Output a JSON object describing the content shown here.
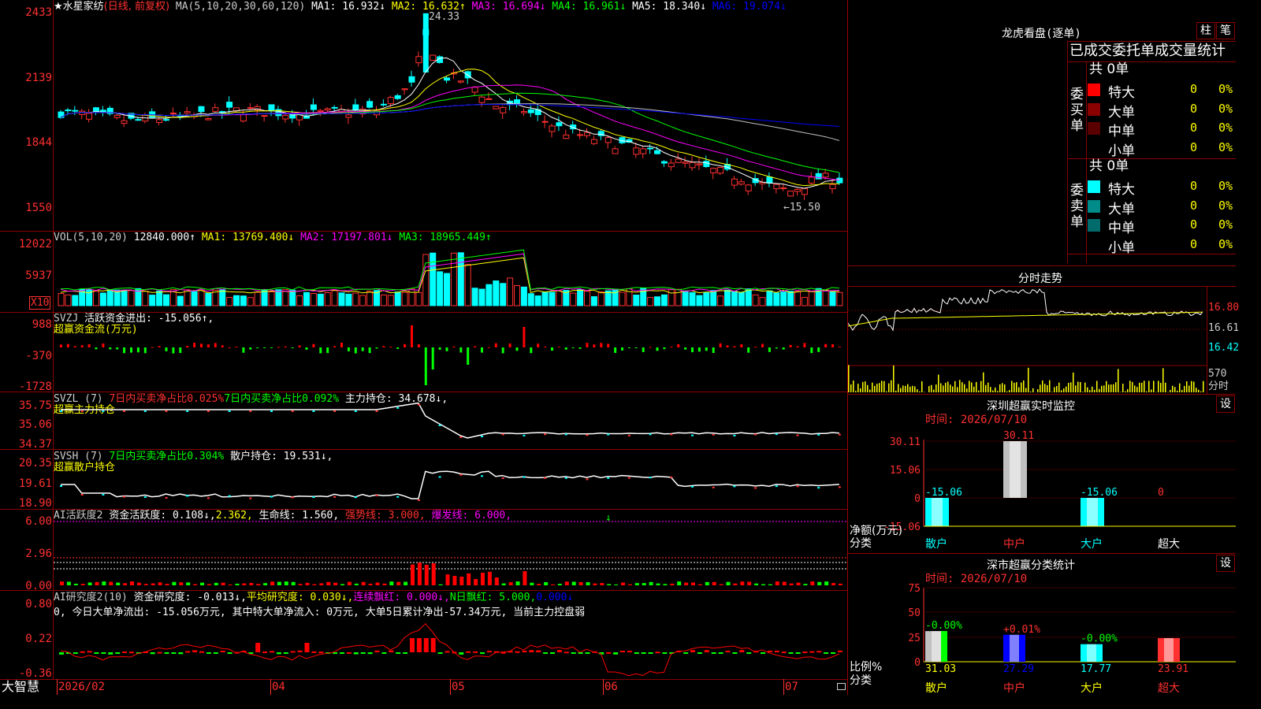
{
  "stock": {
    "name": "★水星家纺",
    "period_label": "(日线, 前复权)",
    "ma_title": "MA(5,10,20,30,60,120)",
    "ma": [
      {
        "label": "MA1: 16.932↓",
        "color": "#ffffff"
      },
      {
        "label": "MA2: 16.632↑",
        "color": "#ffff00"
      },
      {
        "label": "MA3: 16.694↓",
        "color": "#ff00ff"
      },
      {
        "label": "MA4: 16.961↓",
        "color": "#00ff00"
      },
      {
        "label": "MA5: 18.340↓",
        "color": "#ffffff"
      },
      {
        "label": "MA6: 19.074↓",
        "color": "#0000ff"
      }
    ],
    "high_marker": "24.33",
    "low_marker": "←15.50",
    "price_axis": [
      "2433",
      "2139",
      "1844",
      "1550"
    ]
  },
  "vol_panel": {
    "title": "VOL(5,10,20)",
    "value": "12840.000↑",
    "ma1": "MA1: 13769.400↓",
    "ma2": "MA2: 17197.801↓",
    "ma3": "MA3: 18965.449↑",
    "axis": [
      "12022",
      "5937"
    ],
    "unit": "X10"
  },
  "svzj_panel": {
    "title": "SVZJ",
    "label": "活跃资金进出: -15.056↑,",
    "subtitle": "超赢资金流(万元)",
    "axis": [
      "988",
      "-370",
      "-1728"
    ]
  },
  "svzl_panel": {
    "title": "SVZL (7)",
    "label1": "7日内买卖净占比0.025%",
    "label2": "7日内买卖净占比0.092%",
    "label3": "主力持仓: 34.678↓,",
    "subtitle": "超赢主力持仓",
    "axis": [
      "35.75",
      "35.06",
      "34.37"
    ]
  },
  "svsh_panel": {
    "title": "SVSH (7)",
    "label1": "7日内买卖净占比0.304%",
    "label2": "散户持仓: 19.531↓,",
    "subtitle": "超赢散户持仓",
    "axis": [
      "20.35",
      "19.61",
      "18.90"
    ]
  },
  "ai_active_panel": {
    "title": "AI活跃度2",
    "label1": "资金活跃度: 0.108↓,",
    "label2": "2.362,",
    "label3": "生命线: 1.560,",
    "label4": "强势线: 3.000,",
    "label5": "爆发线: 6.000,",
    "axis": [
      "6.00",
      "2.96",
      "0.00"
    ]
  },
  "ai_research_panel": {
    "title": "AI研究度2(10)",
    "label1": "资金研究度: -0.013↓,",
    "label2": "平均研究度: 0.030↓,",
    "label3": "连续飘红: 0.000↓,",
    "label4": "N日飘红: 5.000,",
    "label5": "0.000↓",
    "summary": "0, 今日大单净流出: -15.056万元, 其中特大单净流入: 0万元, 大单5日累计净出-57.34万元, 当前主力控盘弱",
    "axis": [
      "0.80",
      "0.22",
      "-0.36"
    ]
  },
  "date_axis": [
    "2026/02",
    "04",
    "05",
    "06",
    "07"
  ],
  "footer": {
    "brand": "大智慧"
  },
  "lhb": {
    "title": "龙虎看盘(逐单)",
    "btn_bar": "柱",
    "btn_pen": "笔",
    "tabs": "已成交委托单成交量统计",
    "buy_label": "委买单",
    "sell_label": "委卖单",
    "buy_total": "共 0单",
    "sell_total": "共 0单",
    "buy_rows": [
      {
        "name": "特大",
        "v": "0",
        "p": "0%",
        "color": "#ff0000"
      },
      {
        "name": "大单",
        "v": "0",
        "p": "0%",
        "color": "#8b0000"
      },
      {
        "name": "中单",
        "v": "0",
        "p": "0%",
        "color": "#5a0000"
      },
      {
        "name": "小单",
        "v": "0",
        "p": "0%",
        "color": "#000000"
      }
    ],
    "sell_rows": [
      {
        "name": "特大",
        "v": "0",
        "p": "0%",
        "color": "#00ffff"
      },
      {
        "name": "大单",
        "v": "0",
        "p": "0%",
        "color": "#008b8b"
      },
      {
        "name": "中单",
        "v": "0",
        "p": "0%",
        "color": "#006b6b"
      },
      {
        "name": "小单",
        "v": "0",
        "p": "0%",
        "color": "#000000"
      }
    ]
  },
  "intraday": {
    "title": "分时走势",
    "axis": [
      "16.80",
      "16.61",
      "16.42"
    ],
    "vol_label": "570",
    "sub_label": "分时"
  },
  "sz_monitor": {
    "title": "深圳超赢实时监控",
    "btn": "设",
    "time": "时间: 2026/07/10",
    "axis": [
      "30.11",
      "15.06",
      "0",
      "-15.06"
    ],
    "side_label1": "净额(万元)",
    "side_label2": "分类",
    "categories": [
      "散户",
      "中户",
      "大户",
      "超大"
    ],
    "values": [
      "-15.06",
      "30.11",
      "-15.06",
      "0"
    ]
  },
  "sz_class": {
    "title": "深市超赢分类统计",
    "btn": "设",
    "time": "时间: 2026/07/10",
    "axis": [
      "75",
      "50",
      "25",
      "0"
    ],
    "side_label1": "比例%",
    "side_label2": "分类",
    "categories": [
      "散户",
      "中户",
      "大户",
      "超大"
    ],
    "values": [
      "31.03",
      "27.29",
      "17.77",
      "23.91"
    ],
    "changes": [
      "-0.00%",
      "+0.01%",
      "-0.00%",
      ""
    ]
  },
  "chart_data": {
    "type": "table",
    "price_range": [
      15.5,
      24.33
    ],
    "high": 24.33,
    "low": 15.5,
    "monitor_net": {
      "categories": [
        "散户",
        "中户",
        "大户",
        "超大"
      ],
      "values": [
        -15.06,
        30.11,
        -15.06,
        0
      ]
    },
    "class_ratio": {
      "categories": [
        "散户",
        "中户",
        "大户",
        "超大"
      ],
      "values": [
        31.03,
        27.29,
        17.77,
        23.91
      ]
    }
  }
}
